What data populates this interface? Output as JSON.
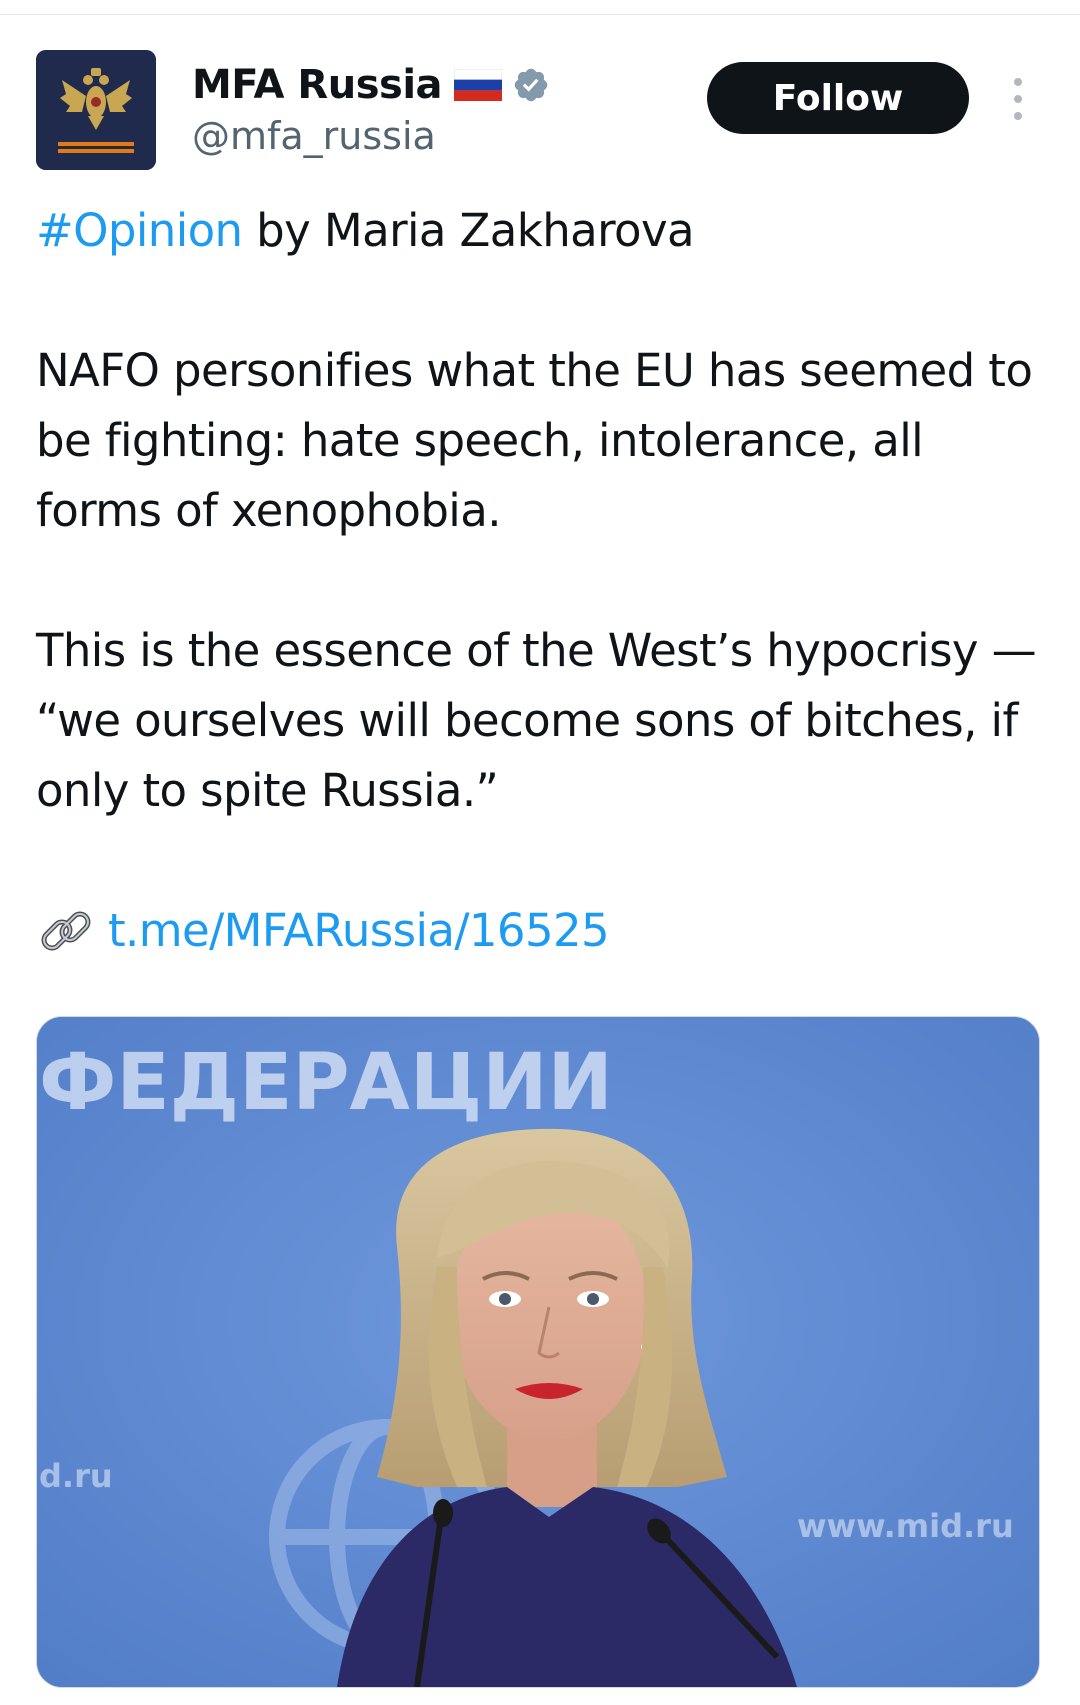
{
  "author": {
    "display_name": "MFA Russia",
    "handle": "@mfa_russia",
    "avatar_icon": "coat-of-arms-icon",
    "flag_icon": "russia-flag-icon",
    "verified_icon": "verified-badge-icon",
    "verified_color": "#829aab"
  },
  "actions": {
    "follow_label": "Follow",
    "more_icon": "more-vertical-icon"
  },
  "tweet": {
    "hashtag": "#Opinion",
    "line1_rest": " by Maria Zakharova",
    "paragraph2": "NAFO personifies what the EU has seemed to be fighting: hate speech, intolerance, all forms of xenophobia.",
    "paragraph3": "This is the essence of the West’s hypocrisy — “we ourselves will become sons of bitches, if only to spite Russia.”",
    "link_icon": "link-emoji-icon",
    "link_text": "t.me/MFARussia/16525"
  },
  "media": {
    "backdrop_text": "ФЕДЕРАЦИИ",
    "backdrop_small_left": "d.ru",
    "backdrop_small_right": "www.mid.ru",
    "description_icon": "photo-image"
  },
  "colors": {
    "link_blue": "#1d9bf0",
    "text_primary": "#0f1419",
    "text_secondary": "#536471",
    "follow_bg": "#0f1419",
    "photo_bg": "#5b86cf"
  }
}
